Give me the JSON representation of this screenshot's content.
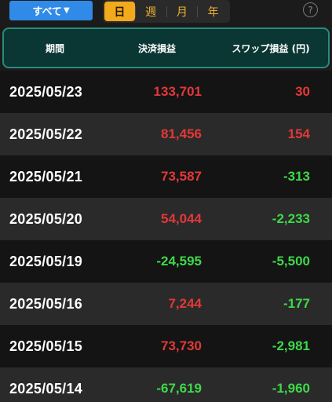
{
  "filter": {
    "label": "すべて",
    "caret": "▼"
  },
  "period_tabs": [
    {
      "label": "日",
      "active": true
    },
    {
      "label": "週",
      "active": false
    },
    {
      "label": "月",
      "active": false
    },
    {
      "label": "年",
      "active": false
    }
  ],
  "help": {
    "symbol": "?"
  },
  "header": {
    "period": "期間",
    "pl": "決済損益",
    "swap": "スワップ損益 (円)"
  },
  "colors": {
    "positive": "#e23838",
    "negative": "#3ed84a",
    "accent": "#f2a91c",
    "filter": "#2f8ae8",
    "header_bg": "#0a3733"
  },
  "rows": [
    {
      "date": "2025/05/23",
      "pl": "133,701",
      "swap": "30"
    },
    {
      "date": "2025/05/22",
      "pl": "81,456",
      "swap": "154"
    },
    {
      "date": "2025/05/21",
      "pl": "73,587",
      "swap": "-313"
    },
    {
      "date": "2025/05/20",
      "pl": "54,044",
      "swap": "-2,233"
    },
    {
      "date": "2025/05/19",
      "pl": "-24,595",
      "swap": "-5,500"
    },
    {
      "date": "2025/05/16",
      "pl": "7,244",
      "swap": "-177"
    },
    {
      "date": "2025/05/15",
      "pl": "73,730",
      "swap": "-2,981"
    },
    {
      "date": "2025/05/14",
      "pl": "-67,619",
      "swap": "-1,960"
    }
  ]
}
